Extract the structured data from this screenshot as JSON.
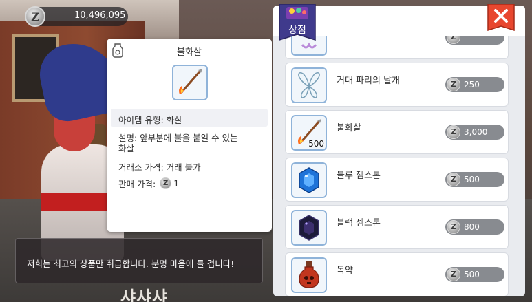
{
  "currency": {
    "icon": "zeny-coin-icon",
    "symbol": "Z",
    "amount": "10,496,095"
  },
  "shop": {
    "badge_label": "상점",
    "close_icon": "close-icon",
    "items": [
      {
        "name": "",
        "price": "",
        "icon": "item-partial-icon"
      },
      {
        "name": "거대 파리의 날개",
        "price": "250",
        "icon": "fly-wing-icon",
        "qty": ""
      },
      {
        "name": "불화살",
        "price": "3,000",
        "icon": "fire-arrow-icon",
        "qty": "500"
      },
      {
        "name": "블루 젬스톤",
        "price": "500",
        "icon": "blue-gemstone-icon",
        "qty": ""
      },
      {
        "name": "블랙 젬스톤",
        "price": "800",
        "icon": "black-gemstone-icon",
        "qty": ""
      },
      {
        "name": "독약",
        "price": "500",
        "icon": "poison-bottle-icon",
        "qty": ""
      }
    ]
  },
  "detail": {
    "title": "불화살",
    "type_line": "아이템 유형: 화살",
    "desc_line1": "설명: 앞부분에 불을 붙일 수 있는",
    "desc_line2": "화살",
    "trade_price": "거래소 가격: 거래 불가",
    "sell_label": "판매 가격:",
    "sell_value": "1",
    "sell_coin": "Z"
  },
  "dialogue": {
    "text": "저희는 최고의 상품만 취급합니다. 분명 마음에 들 겁니다!"
  },
  "background": {
    "sign_text": "샤샤샤"
  },
  "colors": {
    "close_red": "#e8472f",
    "badge_purple": "#3f3a8c",
    "thumb_border": "#8fb3d9",
    "price_pill": "#888b90"
  }
}
